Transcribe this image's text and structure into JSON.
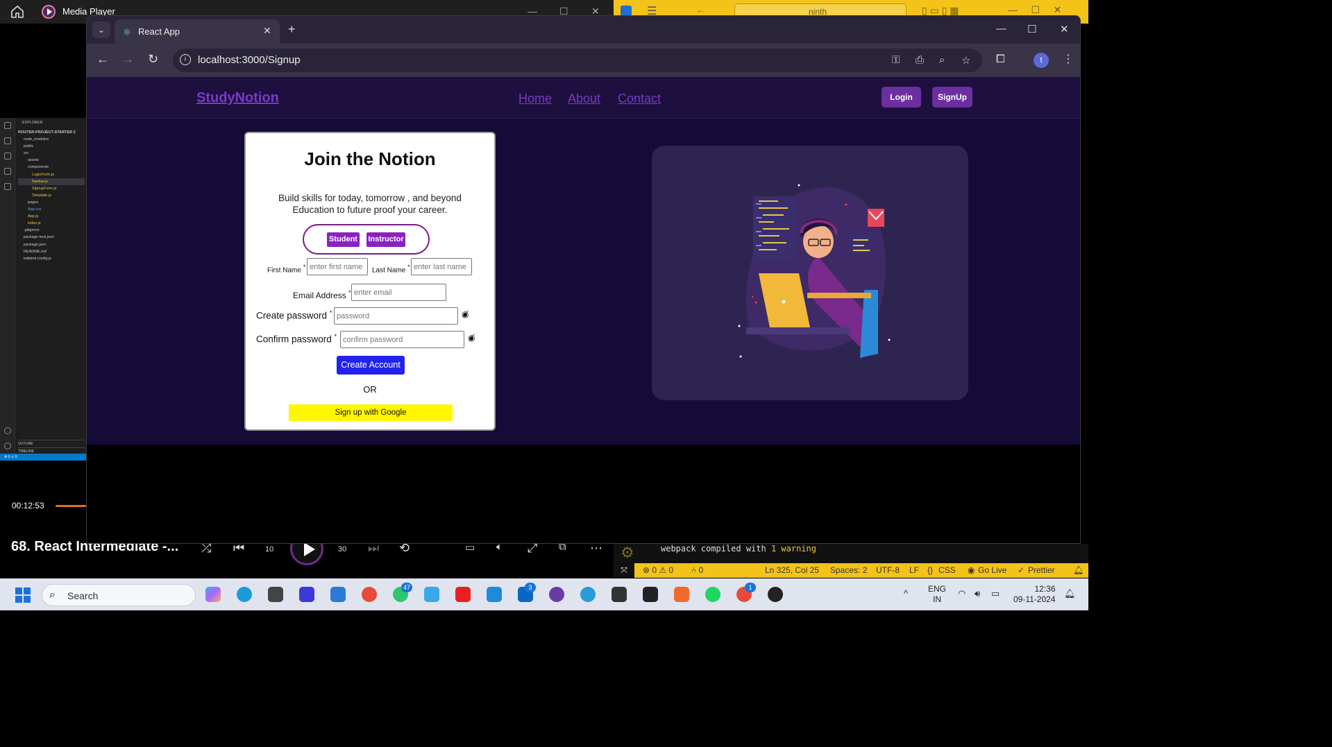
{
  "media_player": {
    "title": "Media Player",
    "elapsed": "00:12:53",
    "video_title": "68. React Intermediate -...",
    "skip_back": "10",
    "skip_forward": "30",
    "explorer": {
      "title": "EXPLORER",
      "project": "ROUTER-PROJECT-STARTER 2",
      "items": [
        "node_modules",
        "public",
        "src",
        "assets",
        "components",
        "LoginForm.js",
        "Navbar.js",
        "SignupForm.js",
        "Template.js",
        "pages",
        "App.css",
        "App.js",
        "index.js",
        ".gitignore",
        "package-lock.json",
        "package.json",
        "README.md",
        "tailwind.config.js"
      ],
      "outline": "OUTLINE",
      "timeline": "TIMELINE",
      "status": "⊗ 0 ⚠ 0"
    }
  },
  "vscode": {
    "search": "ninth",
    "terminal_text": "webpack compiled with ",
    "terminal_warning": "1 warning",
    "status": {
      "problems": "⊗ 0 ⚠ 0",
      "ports": "⑃ 0",
      "cursor": "Ln 325, Col 25",
      "spaces": "Spaces: 2",
      "encoding": "UTF-8",
      "eol": "LF",
      "language": "CSS",
      "golive": "Go Live",
      "prettier": "Prettier"
    }
  },
  "browser": {
    "tab_title": "React App",
    "url": "localhost:3000/Signup",
    "profile_initial": "t"
  },
  "site": {
    "brand": "StudyNotion",
    "nav_links": [
      "Home",
      "About",
      "Contact"
    ],
    "login_label": "Login",
    "signup_label": "SignUp"
  },
  "signup_form": {
    "title": "Join the Notion",
    "desc_line1": "Build skills for today, tomorrow , and beyond",
    "desc_line2": "Education to future proof your career.",
    "role_student": "Student",
    "role_instructor": "Instructor",
    "first_name_label": "First Name",
    "first_name_placeholder": "enter first name",
    "last_name_label": "Last Name",
    "last_name_placeholder": "enter last name",
    "email_label": "Email Address",
    "email_placeholder": "enter email",
    "create_password_label": "Create password",
    "password_placeholder": "password",
    "confirm_password_label": "Confirm password",
    "confirm_password_placeholder": "confirm password",
    "required_mark": "*",
    "create_button": "Create Account",
    "or_text": "OR",
    "google_button": "Sign up with Google"
  },
  "taskbar": {
    "search_label": "Search",
    "whatsapp_badge": "47",
    "linkedin_badge": "3",
    "chrome_badge": "1",
    "lang_line1": "ENG",
    "lang_line2": "IN",
    "time": "12:36",
    "date": "09-11-2024"
  }
}
